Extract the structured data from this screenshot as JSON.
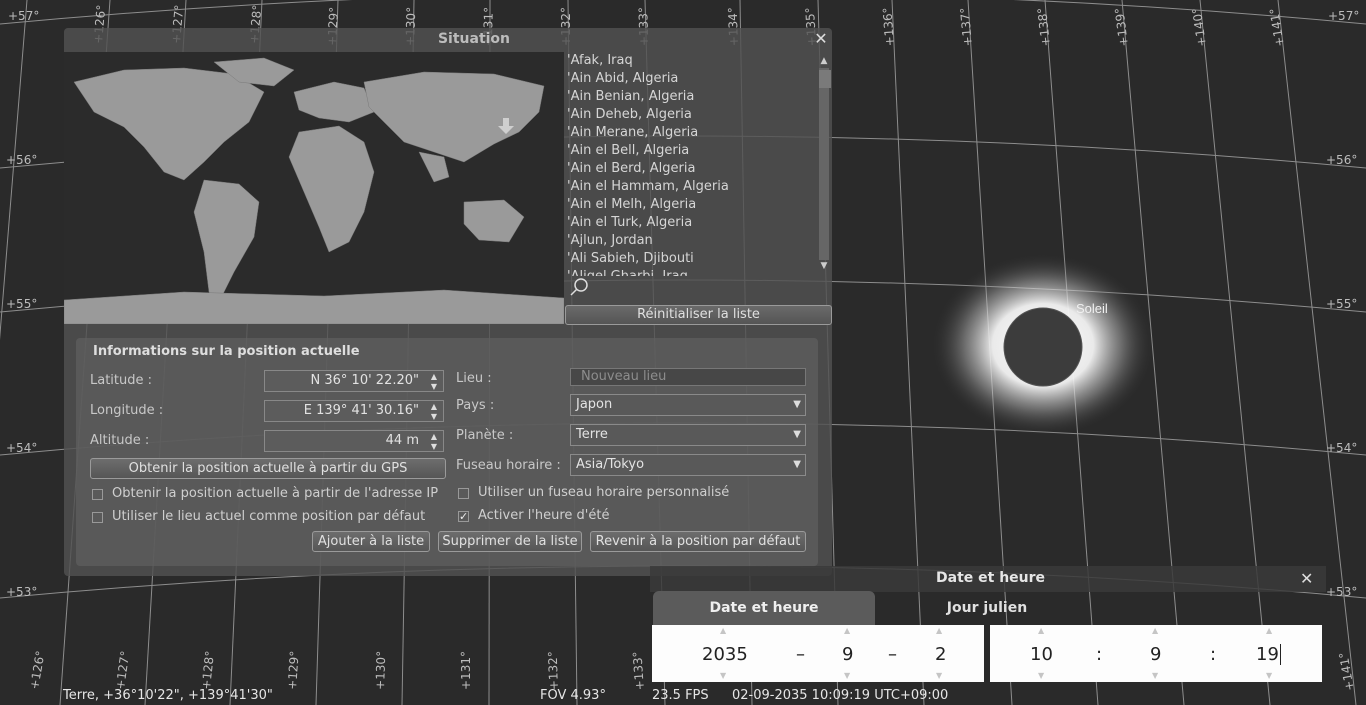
{
  "sky": {
    "sun_label": "Soleil",
    "longitude_labels": [
      "+126°",
      "+127°",
      "+128°",
      "+129°",
      "+130°",
      "+131°",
      "+132°",
      "+133°",
      "+134°",
      "+135°",
      "+136°",
      "+137°",
      "+138°",
      "+139°",
      "+140°",
      "+141°"
    ],
    "latitude_labels": [
      "+57°",
      "+56°",
      "+55°",
      "+54°",
      "+53°"
    ]
  },
  "situation": {
    "title": "Situation",
    "locations": [
      "'Afak, Iraq",
      "'Ain Abid, Algeria",
      "'Ain Benian, Algeria",
      "'Ain Deheb, Algeria",
      "'Ain Merane, Algeria",
      "'Ain el Bell, Algeria",
      "'Ain el Berd, Algeria",
      "'Ain el Hammam, Algeria",
      "'Ain el Melh, Algeria",
      "'Ain el Turk, Algeria",
      "'Ajlun, Jordan",
      "'Ali Sabieh, Djibouti",
      "'Aliqel Gharbi, Iraq"
    ],
    "reset_label": "Réinitialiser la liste",
    "info": {
      "title": "Informations sur la position actuelle",
      "latitude_label": "Latitude :",
      "latitude_value": "N 36° 10' 22.20\"",
      "longitude_label": "Longitude :",
      "longitude_value": "E 139° 41' 30.16\"",
      "altitude_label": "Altitude :",
      "altitude_value": "44 m",
      "gps_button": "Obtenir la position actuelle à partir du GPS",
      "ip_checkbox": "Obtenir la position actuelle à partir de l'adresse IP",
      "default_checkbox": "Utiliser le lieu actuel comme position par défaut",
      "lieu_label": "Lieu :",
      "lieu_placeholder": "Nouveau lieu",
      "pays_label": "Pays :",
      "pays_value": "Japon",
      "planete_label": "Planète :",
      "planete_value": "Terre",
      "fuseau_label": "Fuseau horaire :",
      "fuseau_value": "Asia/Tokyo",
      "custom_tz_checkbox": "Utiliser un fuseau horaire personnalisé",
      "dst_checkbox": "Activer l'heure d'été",
      "dst_checked": true,
      "add_button": "Ajouter à la liste",
      "delete_button": "Supprimer de la liste",
      "revert_button": "Revenir à la position par défaut"
    }
  },
  "datetime": {
    "title": "Date et heure",
    "tab_date": "Date et heure",
    "tab_jd": "Jour julien",
    "year": "2035",
    "month": "9",
    "day": "2",
    "hour": "10",
    "minute": "9",
    "second": "19",
    "date_sep": "–",
    "time_sep": ":"
  },
  "status_bar": {
    "location": "Terre, +36°10'22\", +139°41'30\"",
    "fov": "FOV 4.93°",
    "fps": "23.5 FPS",
    "datetime": "02-09-2035 10:09:19 UTC+09:00"
  }
}
